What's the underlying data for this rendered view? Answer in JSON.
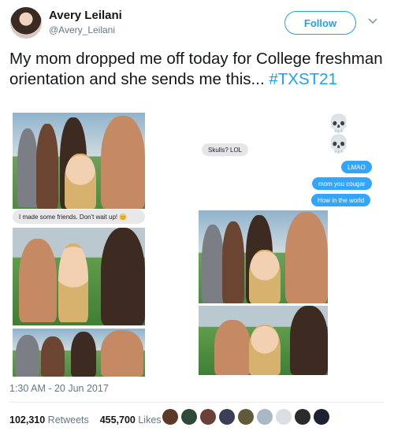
{
  "user": {
    "name": "Avery Leilani",
    "handle": "@Avery_Leilani",
    "follow_label": "Follow"
  },
  "tweet": {
    "text": "My mom dropped me off today for College freshman orientation and she sends me this...",
    "hashtag": "#TXST21"
  },
  "media": {
    "caption": "I made some friends. Don't wait up! 😊",
    "skulls": "💀 💀",
    "messages": [
      {
        "text": "Skulls? LOL",
        "from": "them"
      },
      {
        "text": "LMAO",
        "from": "me"
      },
      {
        "text": "mom you cougar",
        "from": "me"
      },
      {
        "text": "How in the world",
        "from": "me"
      }
    ]
  },
  "meta": {
    "timestamp": "1:30 AM - 20 Jun 2017",
    "retweets_count": "102,310",
    "retweets_label": "Retweets",
    "likes_count": "455,700",
    "likes_label": "Likes"
  },
  "colors": {
    "accent": "#1da1f2",
    "muted": "#657786",
    "imessage_blue": "#34a5ff"
  }
}
